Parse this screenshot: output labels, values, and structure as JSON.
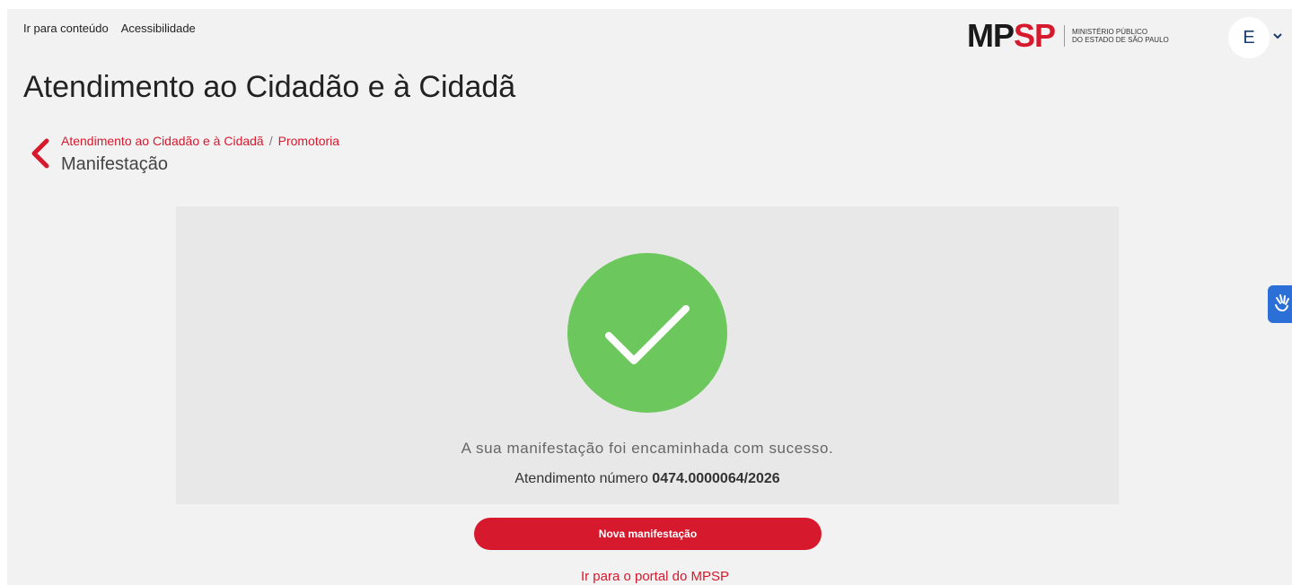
{
  "header": {
    "skip_links": [
      "Ir para conteúdo",
      "Acessibilidade"
    ],
    "logo": {
      "mp": "MP",
      "sp": "SP",
      "line1": "Ministério Público",
      "line2": "do Estado de São Paulo"
    },
    "user_initial": "E",
    "user_chevron": "⌄"
  },
  "page_title": "Atendimento ao Cidadão e à Cidadã",
  "breadcrumb": {
    "items": [
      "Atendimento ao Cidadão e à Cidadã",
      "Promotoria"
    ],
    "separator": "/",
    "current": "Manifestação"
  },
  "result": {
    "message": "A sua manifestação foi encaminhada com sucesso.",
    "protocol_label": "Atendimento número",
    "protocol_number": "0474.0000064/2026"
  },
  "actions": {
    "new_button": "Nova manifestação",
    "portal_link": "Ir para o portal do MPSP"
  },
  "colors": {
    "brand_red": "#d7192d",
    "success_green": "#6cc75c",
    "accessibility_blue": "#2c6fd6"
  },
  "icons": [
    "chevron-left-icon",
    "checkmark-icon",
    "chevron-down-icon",
    "accessibility-hand-icon"
  ]
}
